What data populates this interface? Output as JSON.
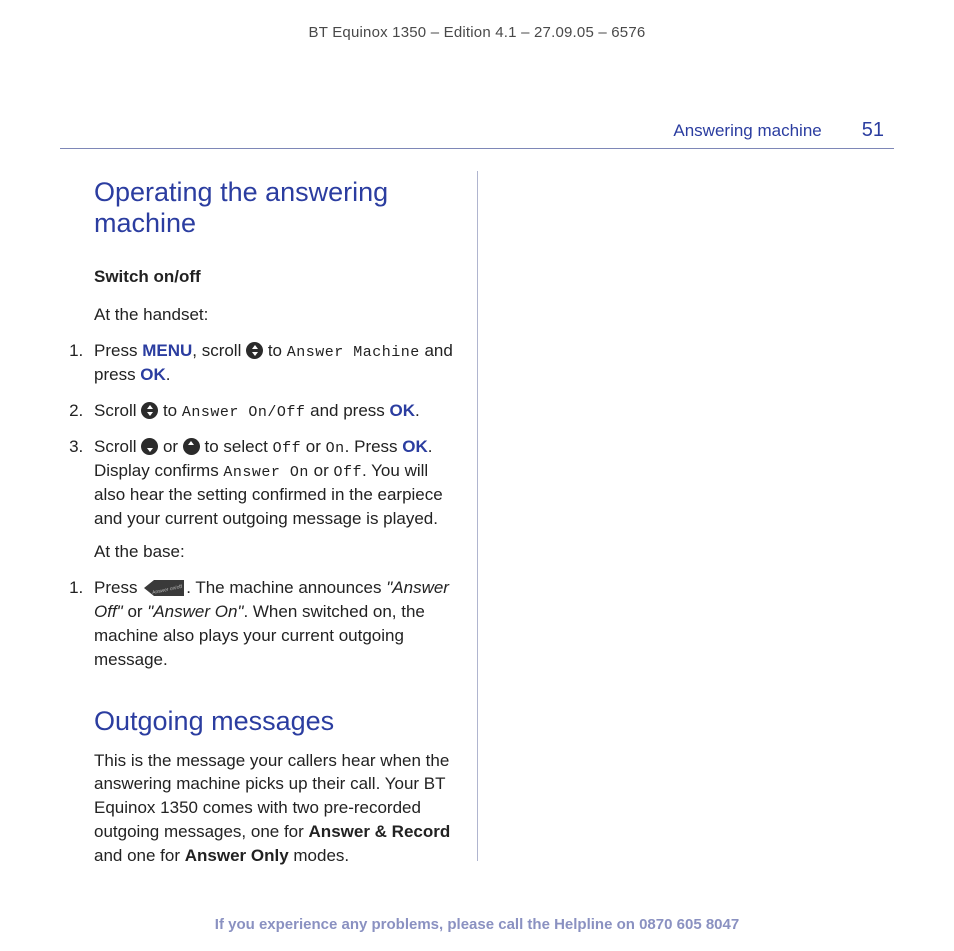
{
  "doc_header": "BT Equinox 1350 – Edition 4.1 – 27.09.05 – 6576",
  "section": "Answering machine",
  "page_number": "51",
  "h1": "Operating the answering machine",
  "subhead": "Switch on/off",
  "at_handset": "At the handset:",
  "step1": {
    "pre": "Press ",
    "menu": "MENU",
    "mid": ", scroll ",
    "to": " to ",
    "lcd": "Answer Machine",
    "post": " and press ",
    "ok": "OK",
    "end": "."
  },
  "step2": {
    "pre": "Scroll ",
    "to": " to ",
    "lcd": "Answer On/Off",
    "post": " and press ",
    "ok": "OK",
    "end": "."
  },
  "step3": {
    "pre": "Scroll ",
    "or": " or ",
    "sel": " to select ",
    "off": "Off",
    "or2": " or ",
    "on": "On",
    "press": ". Press ",
    "ok": "OK",
    "disp": ". Display confirms ",
    "ansOn": "Answer On",
    "or3": " or ",
    "off2": "Off",
    "tail": ". You will also hear the setting confirmed in the earpiece and your current outgoing message is played."
  },
  "at_base": "At the base:",
  "base_step": {
    "pre": "Press ",
    "mid": ". The machine announces ",
    "q1": "\"Answer Off\"",
    "or": " or ",
    "q2": "\"Answer On\"",
    "tail": ". When switched on, the machine also plays your current outgoing message."
  },
  "h2": "Outgoing messages",
  "outgoing_para": {
    "a": "This is the message your callers hear when the answering machine picks up their call. Your BT Equinox 1350 comes with two pre-recorded outgoing messages, one for ",
    "b": "Answer & Record",
    "c": " and one for ",
    "d": "Answer Only",
    "e": " modes."
  },
  "footer_a": "If you experience any problems, please call the Helpline on ",
  "footer_phone": "0870 605 8047"
}
